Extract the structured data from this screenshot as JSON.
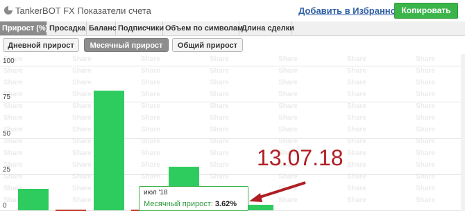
{
  "header": {
    "title": "TankerBOT FX Показатели счета",
    "favorite_link": "Добавить в Избранное",
    "copy_button": "Копировать"
  },
  "tabs": [
    "Прирост (%)",
    "Просадка",
    "Баланс",
    "Подписчики",
    "Объем по символам",
    "Длина сделки"
  ],
  "subtabs": [
    "Дневной прирост",
    "Месячный прирост",
    "Общий прирост"
  ],
  "chart_data": {
    "type": "bar",
    "ylim": [
      0,
      100
    ],
    "y_ticks": [
      "100",
      "75",
      "50",
      "25",
      "0"
    ],
    "values": [
      15,
      0.5,
      83,
      0.5,
      30,
      14,
      3.62
    ],
    "watermark": "Share"
  },
  "tooltip": {
    "date": "июл '18",
    "label": "Месячный прирост:",
    "value": "3.62%"
  },
  "annotation": "13.07.18",
  "colors": {
    "bar": "#2ecc5f",
    "accent_green": "#3bb54a",
    "annotation_red": "#b01e24"
  }
}
